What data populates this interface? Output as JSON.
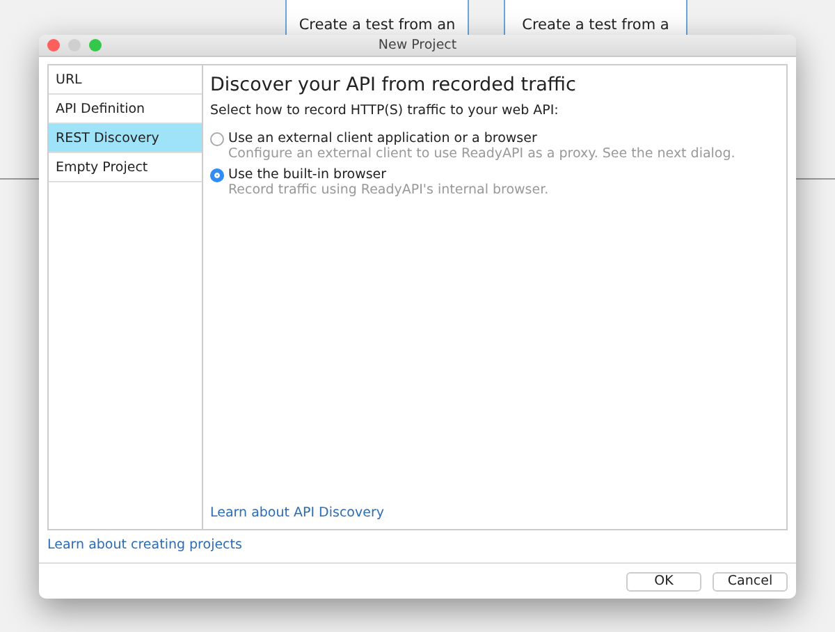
{
  "background_cards": [
    {
      "text": "Create a test from an"
    },
    {
      "text": "Create a test from a"
    }
  ],
  "window": {
    "title": "New Project"
  },
  "sidebar": {
    "items": [
      {
        "label": "URL",
        "selected": false
      },
      {
        "label": "API Definition",
        "selected": false
      },
      {
        "label": "REST Discovery",
        "selected": true
      },
      {
        "label": "Empty Project",
        "selected": false
      }
    ]
  },
  "content": {
    "heading": "Discover your API from recorded traffic",
    "prompt": "Select how to record HTTP(S) traffic to your web API:",
    "options": [
      {
        "label": "Use an external client application or a browser",
        "description": "Configure an external client to use ReadyAPI as a proxy. See the next dialog.",
        "selected": false
      },
      {
        "label": "Use the built-in browser",
        "description": "Record traffic using ReadyAPI's internal browser.",
        "selected": true
      }
    ],
    "link": "Learn about API Discovery"
  },
  "footer_link": "Learn about creating projects",
  "buttons": [
    {
      "label": "OK"
    },
    {
      "label": "Cancel"
    }
  ]
}
